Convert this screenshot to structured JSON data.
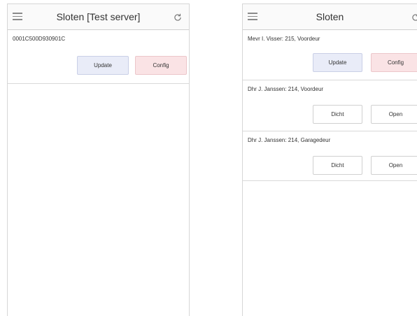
{
  "left_screen": {
    "title": "Sloten [Test server]",
    "items": [
      {
        "name": "0001C500D930901C",
        "buttons": [
          "Update",
          "Config"
        ]
      }
    ]
  },
  "right_screen": {
    "title": "Sloten",
    "items": [
      {
        "name": "Mevr I. Visser: 215, Voordeur",
        "buttons": [
          "Update",
          "Config"
        ]
      },
      {
        "name": "Dhr J. Janssen: 214, Voordeur",
        "buttons": [
          "Dicht",
          "Open"
        ]
      },
      {
        "name": "Dhr J. Janssen: 214, Garagedeur",
        "buttons": [
          "Dicht",
          "Open"
        ]
      }
    ]
  },
  "icons": {
    "menu": "menu-icon",
    "refresh": "refresh-icon"
  },
  "colors": {
    "update_button_bg": "#e9ecf8",
    "config_button_bg": "#fae3e5"
  }
}
